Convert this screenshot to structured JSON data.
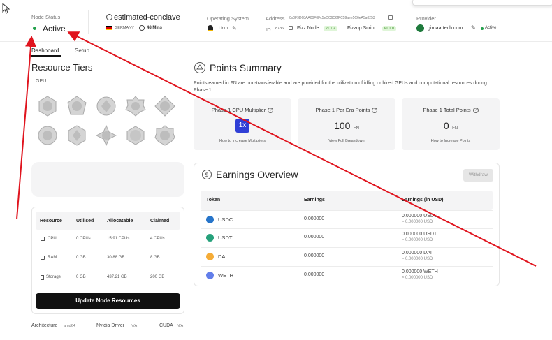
{
  "header": {
    "node_status_label": "Node Status",
    "node_status_value": "Active",
    "node_name": "estimated-conclave",
    "country": "GERMANY",
    "uptime": "48 Mins",
    "os_label": "Operating System",
    "os_value": "Linux",
    "address_label": "Address",
    "address_value": "0x0F9D68AA00F0Fc5eDC6C6fFC59aee5C6eA5a0253",
    "id_label": "ID",
    "id_value": "8736",
    "fizz_node_label": "Fizz Node",
    "fizz_node_version": "v1.1.2",
    "fizzup_label": "Fizzup Script",
    "fizzup_version": "v1.1.0",
    "provider_label": "Provider",
    "provider_value": "girnaartech.com",
    "provider_status": "Active"
  },
  "tabs": [
    {
      "label": "Dashboard"
    },
    {
      "label": "Setup"
    }
  ],
  "resource_tiers": {
    "title": "Resource Tiers",
    "category": "GPU"
  },
  "resources_table": {
    "headers": [
      "Resource",
      "Utilised",
      "Allocatable",
      "Claimed"
    ],
    "rows": [
      {
        "resource": "CPU",
        "utilised": "0 CPUs",
        "allocatable": "15.91 CPUs",
        "claimed": "4 CPUs"
      },
      {
        "resource": "RAM",
        "utilised": "0 GB",
        "allocatable": "30.88 GB",
        "claimed": "8 GB"
      },
      {
        "resource": "Storage",
        "utilised": "0 GB",
        "allocatable": "437.21 GB",
        "claimed": "200 GB"
      }
    ],
    "button_label": "Update Node Resources"
  },
  "specs": {
    "architecture_label": "Architecture",
    "architecture_value": "amd64",
    "nvidia_label": "Nvidia Driver",
    "nvidia_value": "N/A",
    "cuda_label": "CUDA",
    "cuda_value": "N/A"
  },
  "points_summary": {
    "title": "Points Summary",
    "description": "Points earned in FN are non-transferable and are provided for the utilization of idling or hired GPUs and computational resources during Phase 1.",
    "cards": [
      {
        "title": "Phase 1 CPU Multiplier",
        "value": "1x",
        "unit": "",
        "link": "How to Increase Multipliers"
      },
      {
        "title": "Phase 1 Per Era Points",
        "value": "100",
        "unit": "FN",
        "link": "View Full Breakdown"
      },
      {
        "title": "Phase 1 Total Points",
        "value": "0",
        "unit": "FN",
        "link": "How to Increase Points"
      }
    ]
  },
  "earnings": {
    "title": "Earnings Overview",
    "withdraw_label": "Withdraw",
    "headers": [
      "Token",
      "Earnings",
      "Earnings (in USD)"
    ],
    "rows": [
      {
        "token": "USDC",
        "earnings": "0.000000",
        "usd": "0.000000 USDC",
        "usd_sub": "≈ 0.000000 USD",
        "color": "#2775ca"
      },
      {
        "token": "USDT",
        "earnings": "0.000000",
        "usd": "0.000000 USDT",
        "usd_sub": "≈ 0.000000 USD",
        "color": "#26a17b"
      },
      {
        "token": "DAI",
        "earnings": "0.000000",
        "usd": "0.000000 DAI",
        "usd_sub": "≈ 0.000000 USD",
        "color": "#f5ac37"
      },
      {
        "token": "WETH",
        "earnings": "0.000000",
        "usd": "0.000000 WETH",
        "usd_sub": "≈ 0.000000 USD",
        "color": "#627eea"
      }
    ]
  },
  "colors": {
    "accent_active": "#22a04b",
    "annotation_arrow": "#e0141e",
    "multiplier_badge": "#2f3fd6"
  }
}
